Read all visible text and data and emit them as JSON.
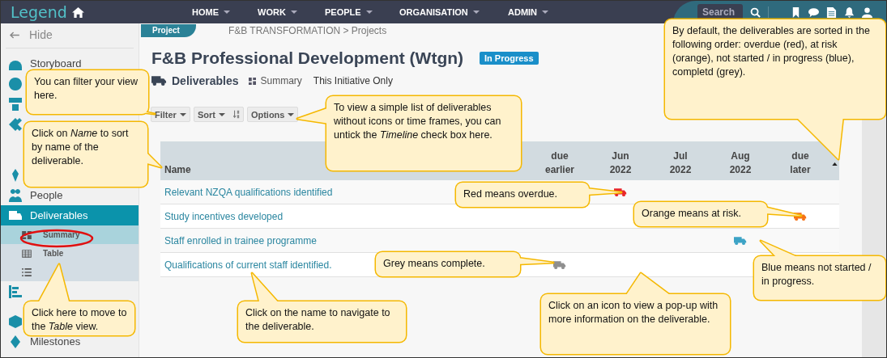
{
  "topbar": {
    "logo": "Legend",
    "nav": [
      {
        "label": "HOME"
      },
      {
        "label": "WORK"
      },
      {
        "label": "PEOPLE"
      },
      {
        "label": "ORGANISATION"
      },
      {
        "label": "ADMIN"
      }
    ],
    "search": {
      "placeholder": "Search"
    }
  },
  "sidebar": {
    "hide": "Hide",
    "items": [
      {
        "label": "Storyboard",
        "selected": false
      },
      {
        "selected": false
      },
      {
        "selected": false
      },
      {
        "selected": false
      },
      {
        "selected": false
      },
      {
        "label": "People",
        "selected": false
      },
      {
        "label": "Deliverables",
        "selected": true,
        "children": [
          {
            "label": "Summary",
            "selected": true
          },
          {
            "label": "Table",
            "selected": false
          },
          {
            "selected": false
          }
        ]
      },
      {
        "selected": false
      },
      {
        "selected": false
      },
      {
        "label": "Milestones",
        "selected": false
      }
    ]
  },
  "page": {
    "tag": "Project",
    "breadcrumb": "F&B TRANSFORMATION > Projects",
    "title": "F&B Professional Development (Wtgn)",
    "status": "In Progress",
    "section": "Deliverables",
    "view": "Summary",
    "scope": "This Initiative Only",
    "buttons": [
      "Filter",
      "Sort",
      "Options"
    ]
  },
  "table": {
    "columns": [
      "Name",
      "due earlier",
      "Jun 2022",
      "Jul 2022",
      "Aug 2022",
      "due later"
    ],
    "rows": [
      {
        "name": "Relevant NZQA qualifications identified",
        "color": "#e8262a",
        "timeline": [
          false,
          true,
          false,
          false,
          false
        ]
      },
      {
        "name": "Study incentives developed",
        "color": "#f57216",
        "timeline": [
          false,
          false,
          false,
          false,
          true
        ]
      },
      {
        "name": "Staff enrolled in trainee programme",
        "color": "#3da3c6",
        "timeline": [
          false,
          false,
          false,
          true,
          false
        ]
      },
      {
        "name": "Qualifications of current staff identified.",
        "color": "#8f8f8f",
        "timeline": [
          true,
          false,
          false,
          false,
          false
        ]
      }
    ]
  },
  "callouts": [
    {
      "text": "You can filter your view  here."
    },
    {
      "text": "Click on *Name* to sort by name of the deliverable."
    },
    {
      "text": "To view a simple list of deliverables without icons or time frames, you can untick the *Timeline* check box here."
    },
    {
      "text": "By default, the deliverables are sorted in the following order: overdue (red), at risk (orange), not started / in progress (blue), completd (grey)."
    },
    {
      "text": "Red means overdue."
    },
    {
      "text": "Orange means at risk."
    },
    {
      "text": "Grey means complete."
    },
    {
      "text": "Blue  means not started / in progress."
    },
    {
      "text": "Click here to move to the *Table* view."
    },
    {
      "text": "Click on the name to navigate to the deliverable."
    },
    {
      "text": "Click on an icon to view a pop-up with more information on the deliverable."
    }
  ]
}
